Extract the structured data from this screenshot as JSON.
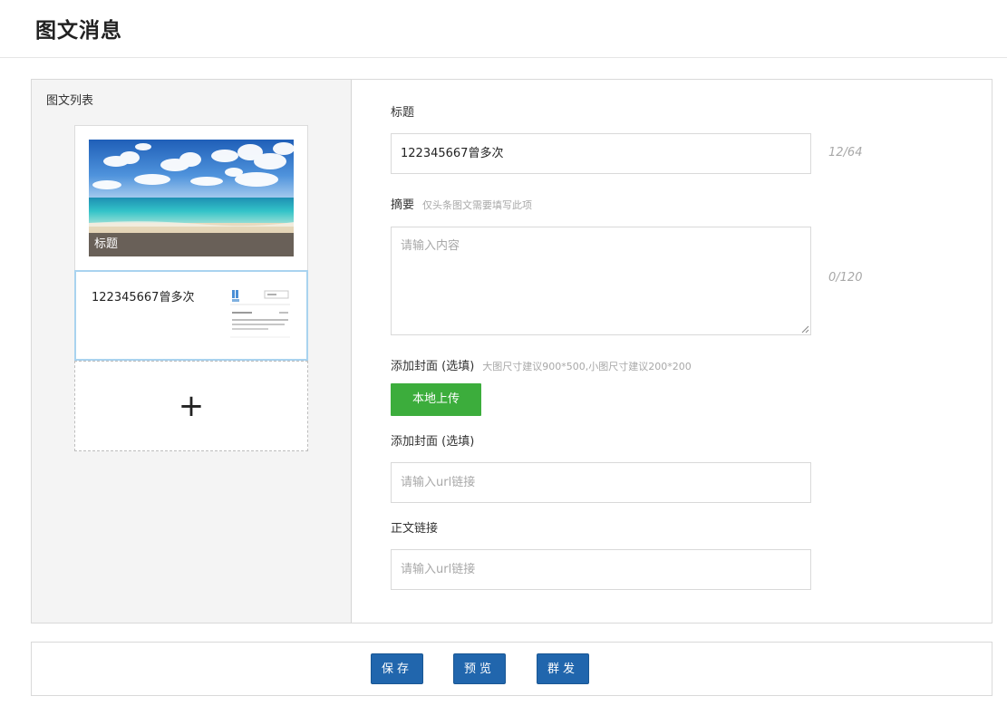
{
  "page": {
    "title": "图文消息"
  },
  "list": {
    "heading": "图文列表",
    "cover_card": {
      "caption": "标题",
      "image": "beach-sea-sky-photo"
    },
    "items": [
      {
        "title": "122345667曾多次",
        "thumbnail": "webpage-screenshot-thumbnail"
      }
    ],
    "add_icon": "+"
  },
  "form": {
    "title": {
      "label": "标题",
      "value": "122345667曾多次",
      "counter": "12/64"
    },
    "summary": {
      "label": "摘要",
      "hint": "仅头条图文需要填写此项",
      "placeholder": "请输入内容",
      "counter": "0/120"
    },
    "cover": {
      "label": "添加封面 (选填)",
      "hint": "大图尺寸建议900*500,小图尺寸建议200*200",
      "upload_label": "本地上传"
    },
    "cover_url": {
      "label": "添加封面 (选填)",
      "placeholder": "请输入url链接"
    },
    "body_link": {
      "label": "正文链接",
      "placeholder": "请输入url链接"
    }
  },
  "actions": {
    "save": "保存",
    "preview": "预览",
    "publish": "群发"
  },
  "colors": {
    "upload_green": "#3cad3c",
    "action_blue": "#2166ad",
    "selected_border": "#a9d3ef",
    "caption_bg": "#645c54"
  }
}
